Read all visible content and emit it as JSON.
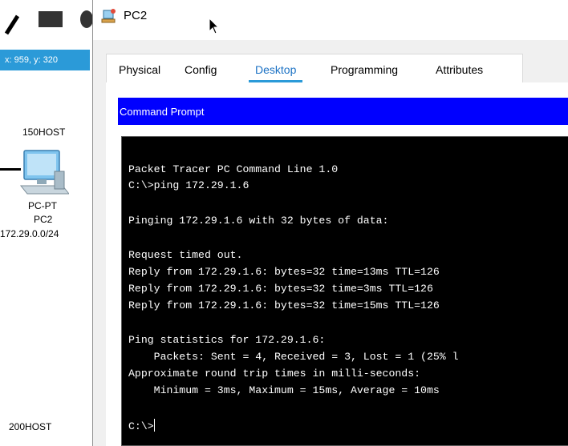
{
  "workspace": {
    "coordinates": "x: 959, y: 320",
    "host_top": "150HOST",
    "device_type": "PC-PT",
    "device_name": "PC2",
    "network": "172.29.0.0/24",
    "host_bottom": "200HOST"
  },
  "window": {
    "title": "PC2",
    "tabs": [
      {
        "label": "Physical"
      },
      {
        "label": "Config"
      },
      {
        "label": "Desktop",
        "active": true
      },
      {
        "label": "Programming"
      },
      {
        "label": "Attributes"
      }
    ],
    "panel_title": "Command Prompt"
  },
  "terminal": {
    "lines": [
      "Packet Tracer PC Command Line 1.0",
      "C:\\>ping 172.29.1.6",
      "",
      "Pinging 172.29.1.6 with 32 bytes of data:",
      "",
      "Request timed out.",
      "Reply from 172.29.1.6: bytes=32 time=13ms TTL=126",
      "Reply from 172.29.1.6: bytes=32 time=3ms TTL=126",
      "Reply from 172.29.1.6: bytes=32 time=15ms TTL=126",
      "",
      "Ping statistics for 172.29.1.6:",
      "    Packets: Sent = 4, Received = 3, Lost = 1 (25% l",
      "Approximate round trip times in milli-seconds:",
      "    Minimum = 3ms, Maximum = 15ms, Average = 10ms",
      "",
      "C:\\>"
    ]
  },
  "colors": {
    "accent": "#2b9ad8",
    "panel_bar": "#0000ff",
    "terminal_bg": "#000000"
  }
}
